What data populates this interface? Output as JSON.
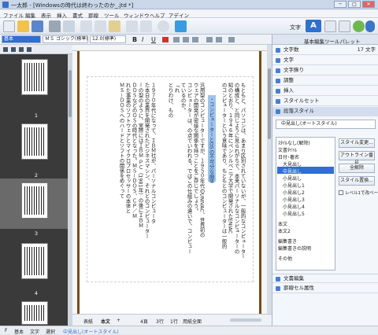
{
  "window": {
    "title": "一太郎 - [Windowsの時代は終わったのか_.jtd *]",
    "minimize": "─",
    "maximize": "□",
    "close": "✕"
  },
  "menu": [
    "ファイル",
    "編集",
    "表示",
    "挿入",
    "書式",
    "罫線",
    "ツール",
    "ウィンドウ",
    "ヘルプ",
    "アデイン"
  ],
  "toolbar": {
    "mode_label": "文字",
    "mode_active": "A",
    "icons": [
      "new-file-icon",
      "open-icon",
      "save-icon",
      "print-icon",
      "preview-icon",
      "cut-icon",
      "copy-icon",
      "paste-icon",
      "undo-icon",
      "redo-icon",
      "search-icon",
      "jump-icon",
      "help-icon"
    ]
  },
  "formatbar": {
    "style_value": "基本",
    "font_value": "ＭＳ ゴシック(標準)",
    "size_value": "12.0(標準)",
    "bold": "B",
    "italic": "I",
    "underline": "U"
  },
  "left_pane": {
    "pages": [
      "1",
      "2",
      "3",
      "4"
    ],
    "selected_page": "3"
  },
  "document": {
    "heading": "・コンピューターとOSの不可分な関係",
    "columns": [
      "もともと、パソコンは、あまり区別されていないが、一般的なコンピューター",
      "の構成と、と同じように見られがちで、本来パーソナルなコンピューターの",
      "知のとおり、１９４６年にペンシルベニア大学で開発されたENIAC",
      "のコンピューターという意味であり、もともとのコンピューターは一般的",
      "汎用型のコンピューターですが、１９５０年代のUNIVAC、世界初の",
      "ウェアの開発が密接な関係を持つことをご存じでしょう。",
      "コンピューターは、の点でいわれる。ではこの仕組みの違いで、コンピュー",
      "ているのか。",
      "「れ",
      "とりわけ、もの",
      "１９７０年代になって、ＩＢＭ社が、パーソナルコンピュータ",
      "た本日の業界を開発されたビジネスマシン、それとのコンピューター",
      "ーの型のように、実際にはＩＢＭ ＰＣ（1981年）の後にＩＢＭ",
      "ＤＯＳなどのＯＳの時代となった。ＭＳ－ＤＯＳ、ＣＰ／Ｍ",
      "れた事業のソフトウェアとマイクロプロセッサーの本体と",
      "ＭＳ－ＤＯＳへのハードとソフトの関係をめぐって"
    ]
  },
  "docbar": {
    "tabs": [
      "表紙",
      "本文"
    ],
    "add": "+",
    "page": "4頁",
    "line": "3行",
    "char": "1行",
    "edit_mode": "用紙全面"
  },
  "statusbar": {
    "items": [
      "F",
      "基本",
      "文字",
      "選択",
      "中見出し(オートスタイル)"
    ]
  },
  "right_panel": {
    "title": "基本編集ツールパレット",
    "sections": [
      "文字数",
      "文字",
      "文字飾り",
      "調整",
      "挿入",
      "スタイルセット",
      "段落スタイル"
    ],
    "char_count_value": "17 文字",
    "current_style": "中見出し(オートスタイル)",
    "style_list": [
      "ｽﾀｲﾙなし(解除)",
      "文書ﾀｲﾄﾙ",
      "日付･著名",
      "大見出し",
      "中見出し",
      "小見出し",
      "小見出し1",
      "小見出し2",
      "小見出し3",
      "小見出し4",
      "小見出し5",
      "本文",
      "本文2",
      "編集書き",
      "編集書きの説明",
      "その他"
    ],
    "selected_style": "中見出し",
    "buttons": [
      "スタイル変更...",
      "アウトライン番号",
      "全解除",
      "スタイル置換..."
    ],
    "checkbox_label": "レベル1で改ページ",
    "bottom_sections": [
      "文書編集",
      "罫線セル属性"
    ]
  },
  "colors": {
    "accent": "#3a6fc4",
    "heading_highlight": "#9fc5ec",
    "page_margin": "#7a4a1a"
  }
}
